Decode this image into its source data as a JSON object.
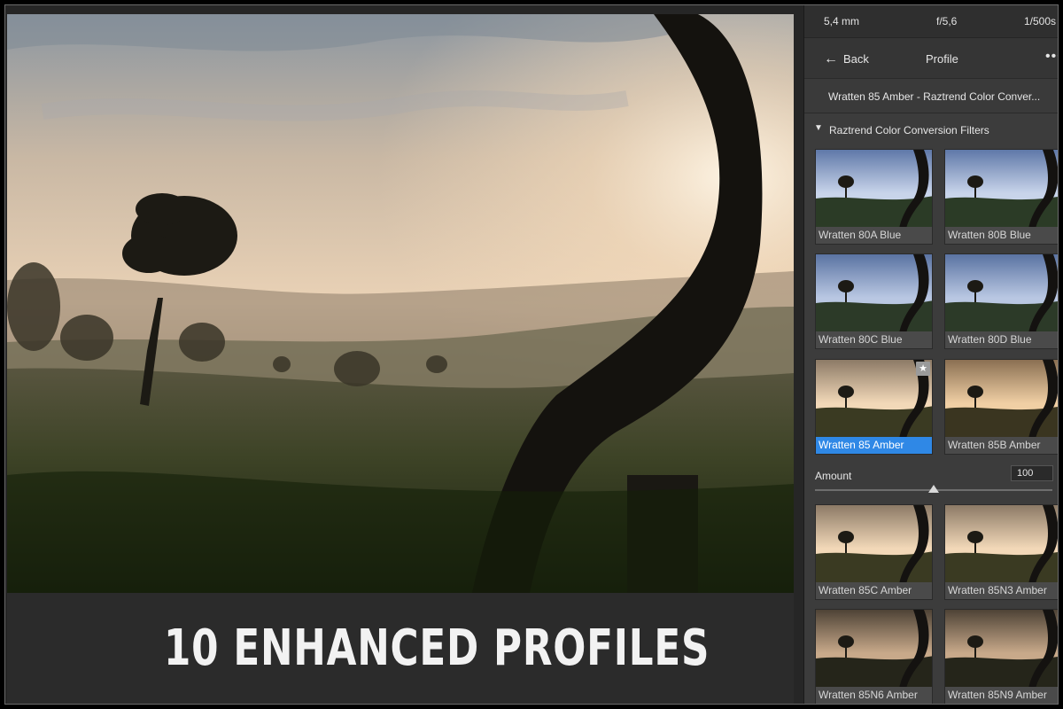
{
  "caption": "10 ENHANCED PROFILES",
  "exif": {
    "focal": "5,4 mm",
    "aperture": "f/5,6",
    "shutter": "1/500s"
  },
  "header": {
    "back_label": "Back",
    "title": "Profile",
    "more": "•••"
  },
  "current_profile": "Wratten 85 Amber - Raztrend Color Conver...",
  "group": {
    "collapse_glyph": "▼",
    "name": "Raztrend Color Conversion Filters"
  },
  "amount": {
    "label": "Amount",
    "value": "100",
    "fraction": 0.5
  },
  "profiles": [
    {
      "label": "Wratten 80A Blue",
      "tone": "blue",
      "selected": false,
      "favorite": false
    },
    {
      "label": "Wratten 80B Blue",
      "tone": "blue",
      "selected": false,
      "favorite": false
    },
    {
      "label": "Wratten 80C Blue",
      "tone": "blue2",
      "selected": false,
      "favorite": false
    },
    {
      "label": "Wratten 80D Blue",
      "tone": "blue2",
      "selected": false,
      "favorite": false
    },
    {
      "label": "Wratten 85 Amber",
      "tone": "amber",
      "selected": true,
      "favorite": true
    },
    {
      "label": "Wratten 85B Amber",
      "tone": "amber2",
      "selected": false,
      "favorite": false
    },
    {
      "label": "Wratten 85C Amber",
      "tone": "amber",
      "selected": false,
      "favorite": false
    },
    {
      "label": "Wratten 85N3 Amber",
      "tone": "amber",
      "selected": false,
      "favorite": false
    },
    {
      "label": "Wratten 85N6 Amber",
      "tone": "dark",
      "selected": false,
      "favorite": false
    },
    {
      "label": "Wratten 85N9 Amber",
      "tone": "dark",
      "selected": false,
      "favorite": false
    }
  ],
  "colors": {
    "accent": "#2f88e6",
    "panel_bg": "#3c3c3c",
    "caption_bar": "#2b2b2b"
  }
}
